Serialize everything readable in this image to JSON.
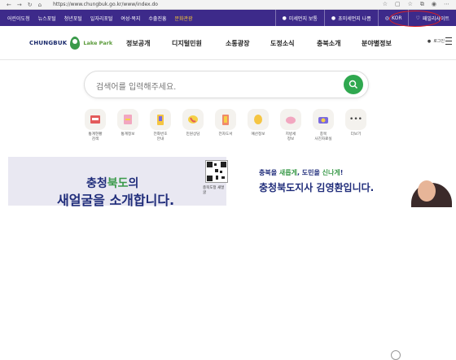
{
  "browser": {
    "url": "https://www.chungbuk.go.kr/www/index.do",
    "nav_icons": [
      "back-icon",
      "forward-icon",
      "refresh-icon",
      "home-icon"
    ],
    "tool_icons": [
      "star-icon",
      "tab-icon",
      "favorites-icon",
      "collections-icon",
      "profile-icon",
      "more-icon"
    ]
  },
  "topbar": {
    "links": [
      "어린이도청",
      "뉴스포털",
      "청년포털",
      "일자리포털",
      "여성·복지",
      "수출진흥",
      "문화관광"
    ],
    "highlight_index": 6,
    "right": [
      "미세먼지 보통",
      "초미세먼지 나쁨",
      "KOR",
      "패밀리사이트"
    ],
    "bg_color": "#3d2a8a"
  },
  "header": {
    "logo_brand": "CHUNGBUK",
    "logo_sub": "Lake Park",
    "gnb": [
      "정보공개",
      "디지털민원",
      "소통광장",
      "도정소식",
      "충북소개",
      "분야별정보"
    ],
    "login": "로그인"
  },
  "search": {
    "placeholder": "검색어를 입력해주세요."
  },
  "quick_menu": [
    {
      "label": "통계현황\n검색",
      "icon": "stats-icon"
    },
    {
      "label": "통계정보",
      "icon": "chart-icon"
    },
    {
      "label": "전화번호\n안내",
      "icon": "phone-book-icon"
    },
    {
      "label": "민원상담",
      "icon": "call-icon"
    },
    {
      "label": "전자도서",
      "icon": "ebook-icon"
    },
    {
      "label": "예산정보",
      "icon": "coin-icon"
    },
    {
      "label": "지방세\n정보",
      "icon": "piggy-bank-icon"
    },
    {
      "label": "충북\n사진자료실",
      "icon": "camera-icon"
    },
    {
      "label": "더보기",
      "icon": "more-dots-icon"
    }
  ],
  "banner": {
    "left_line1_a": "충청",
    "left_line1_b": "북도",
    "left_line1_c": "의",
    "left_line2": "새얼굴을 소개합니다.",
    "qr_caption": "충북도정 새얼굴",
    "right_line1_a": "충북을 ",
    "right_line1_b": "새롭게",
    "right_line1_c": ", 도민을 ",
    "right_line1_d": "신나게",
    "right_line1_e": "!",
    "right_line2": "충청북도지사 김영환입니다."
  }
}
